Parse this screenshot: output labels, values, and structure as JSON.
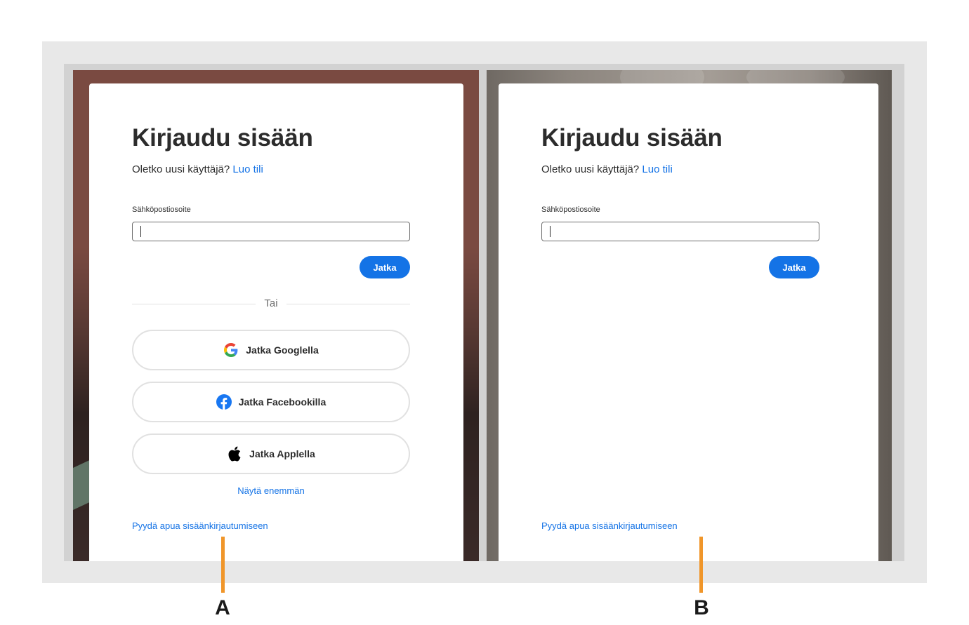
{
  "panels": [
    {
      "id": "A",
      "title": "Kirjaudu sisään",
      "new_user_prompt": "Oletko uusi käyttäjä?",
      "create_account_link": "Luo tili",
      "email_label": "Sähköpostiosoite",
      "email_value": "",
      "continue_button": "Jatka",
      "divider_text": "Tai",
      "social_buttons": [
        {
          "label": "Jatka Googlella",
          "icon": "google-icon"
        },
        {
          "label": "Jatka Facebookilla",
          "icon": "facebook-icon"
        },
        {
          "label": "Jatka Applella",
          "icon": "apple-icon"
        }
      ],
      "show_more_link": "Näytä enemmän",
      "help_link": "Pyydä apua sisäänkirjautumiseen"
    },
    {
      "id": "B",
      "title": "Kirjaudu sisään",
      "new_user_prompt": "Oletko uusi käyttäjä?",
      "create_account_link": "Luo tili",
      "email_label": "Sähköpostiosoite",
      "email_value": "",
      "continue_button": "Jatka",
      "help_link": "Pyydä apua sisäänkirjautumiseen"
    }
  ],
  "callouts": [
    {
      "label": "A",
      "color": "#f0962a"
    },
    {
      "label": "B",
      "color": "#f0962a"
    }
  ],
  "colors": {
    "accent": "#1473e6",
    "callout": "#f0962a",
    "text": "#2c2c2c"
  }
}
